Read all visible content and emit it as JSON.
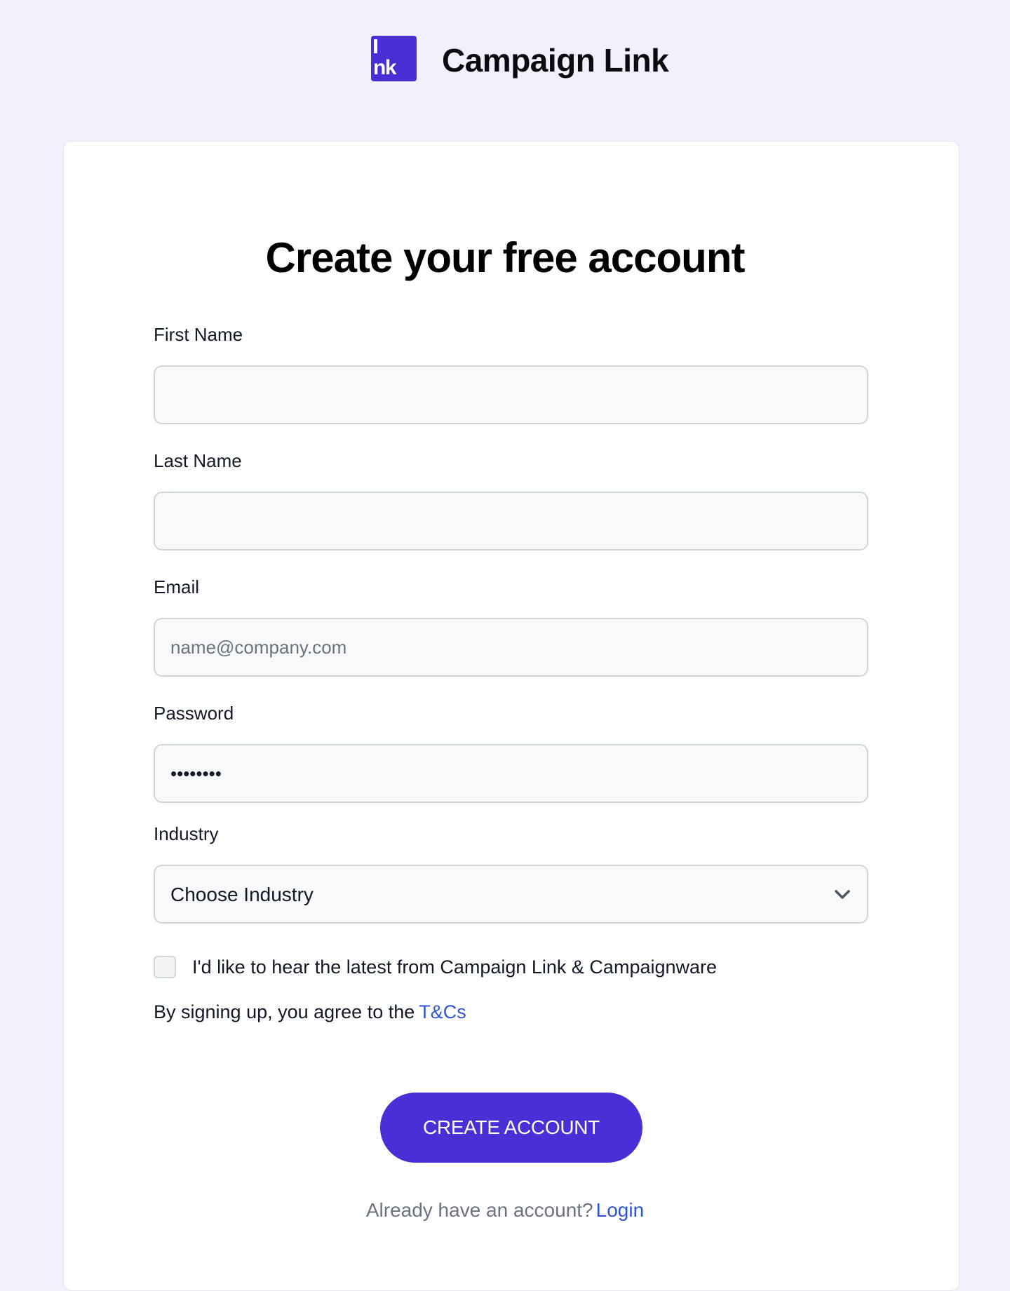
{
  "brand": {
    "name": "Campaign Link",
    "logo_text": "nk"
  },
  "form": {
    "title": "Create your free account",
    "first_name": {
      "label": "First Name",
      "value": "",
      "placeholder": ""
    },
    "last_name": {
      "label": "Last Name",
      "value": "",
      "placeholder": ""
    },
    "email": {
      "label": "Email",
      "value": "",
      "placeholder": "name@company.com"
    },
    "password": {
      "label": "Password",
      "value": "••••••••",
      "placeholder": ""
    },
    "industry": {
      "label": "Industry",
      "selected": "Choose Industry"
    },
    "newsletter": {
      "label": "I'd like to hear the latest from Campaign Link & Campaignware",
      "checked": false
    },
    "terms": {
      "prefix": "By signing up, you agree to the",
      "link_label": "T&Cs"
    },
    "submit_label": "CREATE ACCOUNT",
    "login": {
      "prefix": "Already have an account?",
      "link_label": "Login"
    }
  },
  "colors": {
    "accent": "#4a2fd6",
    "link": "#2f55d4",
    "background": "#f1f0fd"
  }
}
